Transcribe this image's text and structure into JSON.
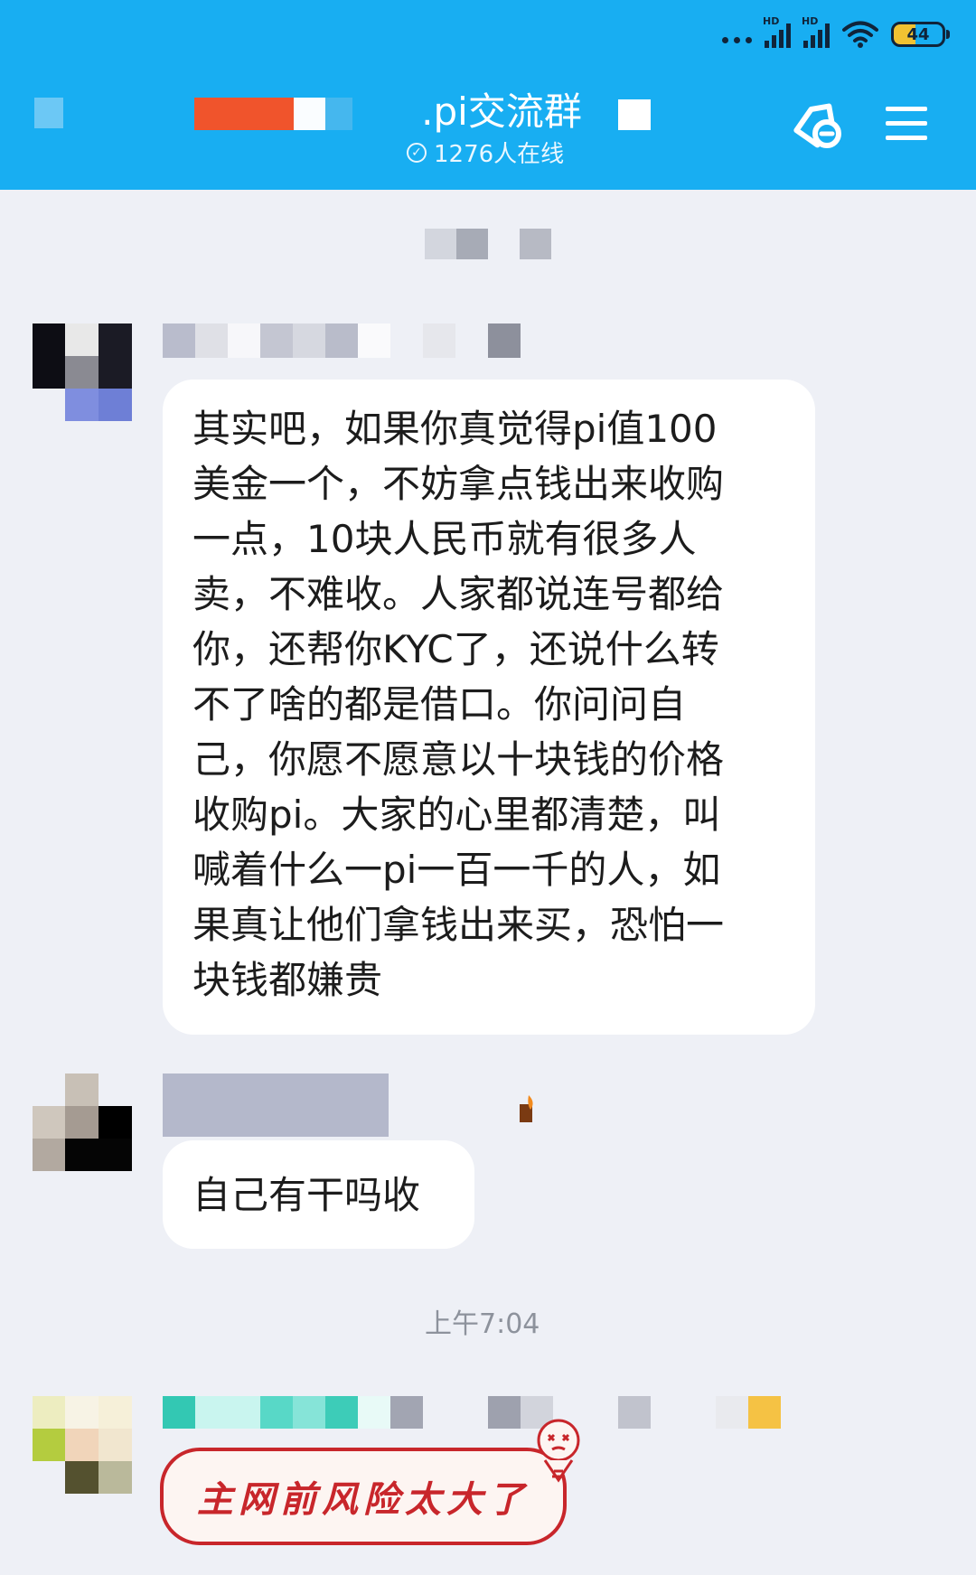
{
  "status_bar": {
    "network_left": "HD",
    "network_right": "HD",
    "battery": "44",
    "colors": {
      "battery_fill": "#f1c232"
    }
  },
  "header": {
    "title": ".pi交流群",
    "online_count": "1276人在线",
    "icons": {
      "shortcut": "tag-link-icon",
      "menu": "hamburger-menu-icon"
    },
    "colors": {
      "background": "#18aef2"
    }
  },
  "messages": [
    {
      "sender_name_redacted": true,
      "type": "text",
      "lines": [
        "其实吧，如果你真觉得pi值100",
        "美金一个，不妨拿点钱出来收购",
        "一点，10块人民币就有很多人",
        "卖，不难收。人家都说连号都给",
        "你，还帮你KYC了，还说什么转",
        "不了啥的都是借口。你问问自",
        "己，你愿不愿意以十块钱的价格",
        "收购pi。大家的心里都清楚，叫",
        "喊着什么一pi一百一千的人，如",
        "果真让他们拿钱出来买，恐怕一",
        "块钱都嫌贵"
      ]
    },
    {
      "sender_name_redacted": true,
      "type": "text",
      "text": "自己有干吗收"
    }
  ],
  "time_divider": "上午7:04",
  "sticker_message": {
    "sender_name_redacted": true,
    "text": "主网前风险太大了",
    "colors": {
      "accent": "#c8262b"
    }
  }
}
